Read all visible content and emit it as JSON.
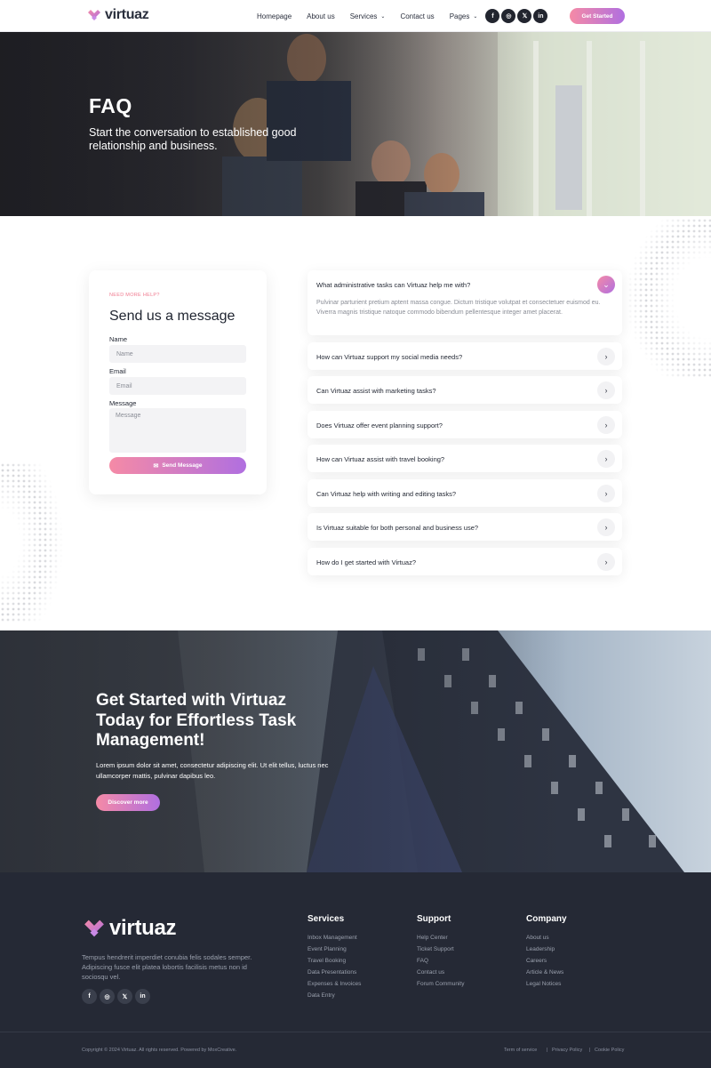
{
  "brand": {
    "name": "virtuaz",
    "accent_pink": "#f58aa6",
    "accent_purple": "#b06fe0",
    "dark": "#252935"
  },
  "nav": {
    "items": [
      "Homepage",
      "About us",
      "Services",
      "Contact us",
      "Pages"
    ],
    "social": [
      "facebook-icon",
      "instagram-icon",
      "x-icon",
      "linkedin-icon"
    ],
    "social_glyphs": [
      "f",
      "◎",
      "𝕏",
      "in"
    ],
    "cta": "Get Started"
  },
  "hero": {
    "title": "FAQ",
    "subtitle": "Start the conversation to established good relationship and business."
  },
  "contact": {
    "eyebrow": "NEED MORE HELP?",
    "title": "Send us a message",
    "name_label": "Name",
    "name_placeholder": "Name",
    "email_label": "Email",
    "email_placeholder": "Email",
    "message_label": "Message",
    "message_placeholder": "Message",
    "send": "Send Message"
  },
  "faq": [
    {
      "q": "What administrative tasks can Virtuaz help me with?",
      "a": "Pulvinar parturient pretium aptent massa congue. Dictum tristique volutpat et consectetuer euismod eu. Viverra magnis tristique natoque commodo bibendum pellentesque integer amet placerat.",
      "open": true
    },
    {
      "q": "How can Virtuaz support my social media needs?"
    },
    {
      "q": "Can Virtuaz assist with marketing tasks?"
    },
    {
      "q": "Does Virtuaz offer event planning support?"
    },
    {
      "q": "How can Virtuaz assist with travel booking?"
    },
    {
      "q": "Can Virtuaz help with writing and editing tasks?"
    },
    {
      "q": "Is Virtuaz suitable for both personal and business use?"
    },
    {
      "q": "How do I get started with Virtuaz?"
    }
  ],
  "cta": {
    "title": "Get Started with Virtuaz Today for Effortless Task Management!",
    "text": "Lorem ipsum dolor sit amet, consectetur adipiscing elit. Ut elit tellus, luctus nec ullamcorper mattis, pulvinar dapibus leo.",
    "button": "Discover more"
  },
  "footer": {
    "description": "Tempus hendrerit imperdiet conubia felis sodales semper. Adipiscing fusce elit platea lobortis facilisis metus non id sociosqu vel.",
    "columns": [
      {
        "title": "Services",
        "links": [
          "Inbox Management",
          "Event Planning",
          "Travel Booking",
          "Data Presentations",
          "Expenses & Invoices",
          "Data Entry"
        ]
      },
      {
        "title": "Support",
        "links": [
          "Help Center",
          "Ticket Support",
          "FAQ",
          "Contact us",
          "Forum Community"
        ]
      },
      {
        "title": "Company",
        "links": [
          "About us",
          "Leadership",
          "Careers",
          "Article & News",
          "Legal Notices"
        ]
      }
    ],
    "copyright": "Copyright © 2024 Virtuaz. All rights reserved. Powered by MoxCreative.",
    "legal": [
      "Term of service",
      "Privacy Policy",
      "Cookie Policy"
    ]
  }
}
